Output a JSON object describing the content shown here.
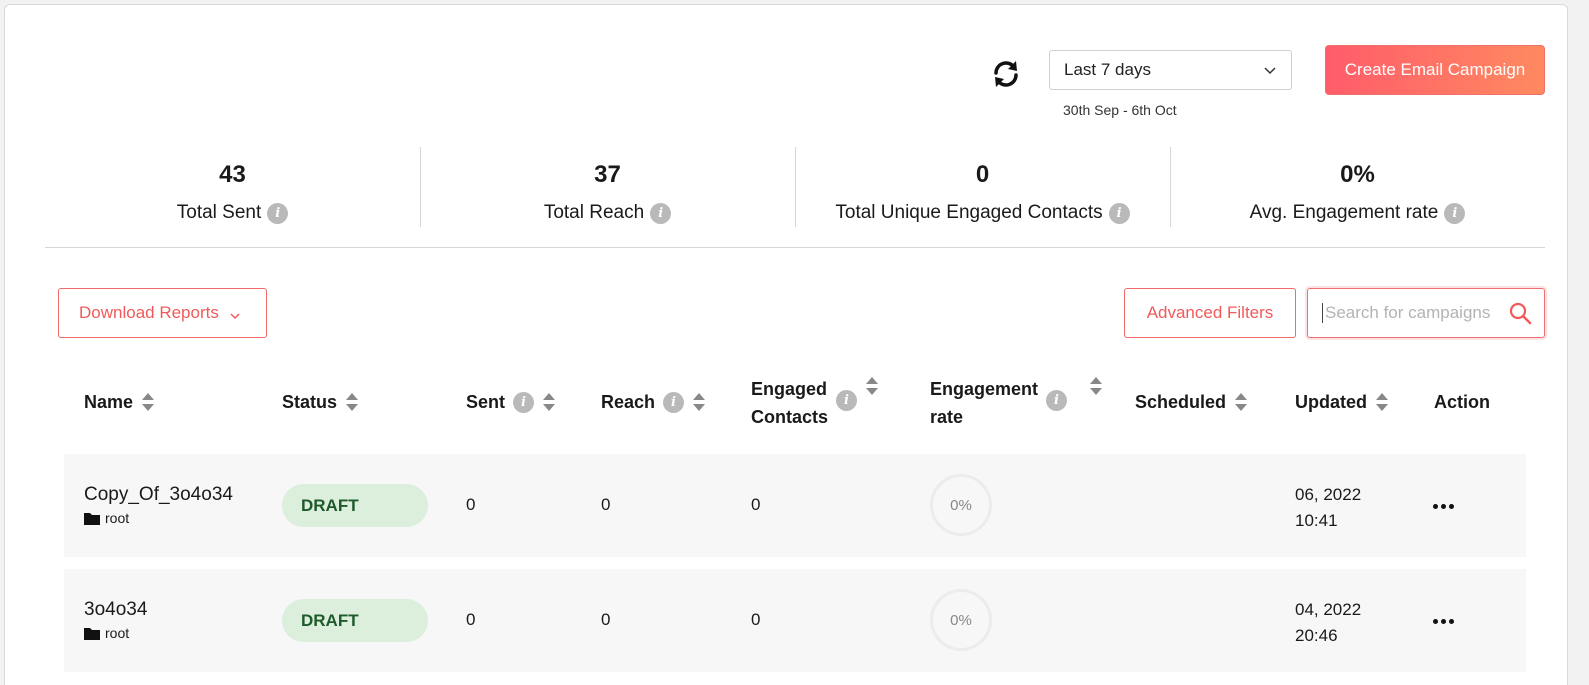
{
  "header": {
    "date_range_label": "Last 7 days",
    "date_range_sub": "30th Sep - 6th Oct",
    "create_label": "Create Email Campaign",
    "accent_color": "#ff6b6b"
  },
  "stats": [
    {
      "value": "43",
      "label": "Total Sent"
    },
    {
      "value": "37",
      "label": "Total Reach"
    },
    {
      "value": "0",
      "label": "Total Unique Engaged Contacts"
    },
    {
      "value": "0%",
      "label": "Avg. Engagement rate"
    }
  ],
  "toolbar": {
    "download_label": "Download Reports",
    "filters_label": "Advanced Filters",
    "search_placeholder": "Search for campaigns"
  },
  "table": {
    "columns": {
      "name": "Name",
      "status": "Status",
      "sent": "Sent",
      "reach": "Reach",
      "engaged_1": "Engaged",
      "engaged_2": "Contacts",
      "rate_1": "Engagement",
      "rate_2": "rate",
      "scheduled": "Scheduled",
      "updated": "Updated",
      "action": "Action"
    },
    "rows": [
      {
        "name": "Copy_Of_3o4o34",
        "folder": "root",
        "status": "DRAFT",
        "sent": "0",
        "reach": "0",
        "engaged": "0",
        "rate": "0%",
        "updated_1": "06, 2022",
        "updated_2": "10:41"
      },
      {
        "name": "3o4o34",
        "folder": "root",
        "status": "DRAFT",
        "sent": "0",
        "reach": "0",
        "engaged": "0",
        "rate": "0%",
        "updated_1": "04, 2022",
        "updated_2": "20:46"
      }
    ]
  }
}
